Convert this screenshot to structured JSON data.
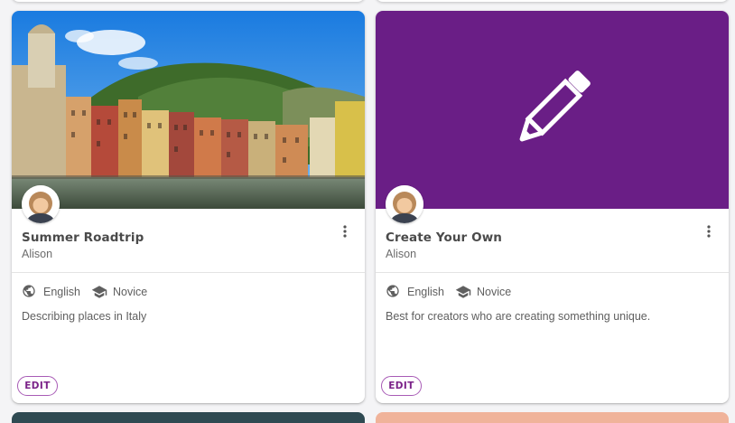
{
  "cards": [
    {
      "title": "Summer Roadtrip",
      "author": "Alison",
      "language": "English",
      "level": "Novice",
      "description": "Describing places in Italy",
      "edit_label": "EDIT",
      "hero": "photo"
    },
    {
      "title": "Create Your Own",
      "author": "Alison",
      "language": "English",
      "level": "Novice",
      "description": "Best for creators who are creating something unique.",
      "edit_label": "EDIT",
      "hero": "pencil-icon"
    }
  ],
  "colors": {
    "accent": "#7b2389",
    "hero_purple": "#6a1e86",
    "background": "#f4f4f6"
  },
  "icons": [
    "globe-icon",
    "graduation-cap-icon",
    "more-vert-icon",
    "pencil-icon"
  ]
}
